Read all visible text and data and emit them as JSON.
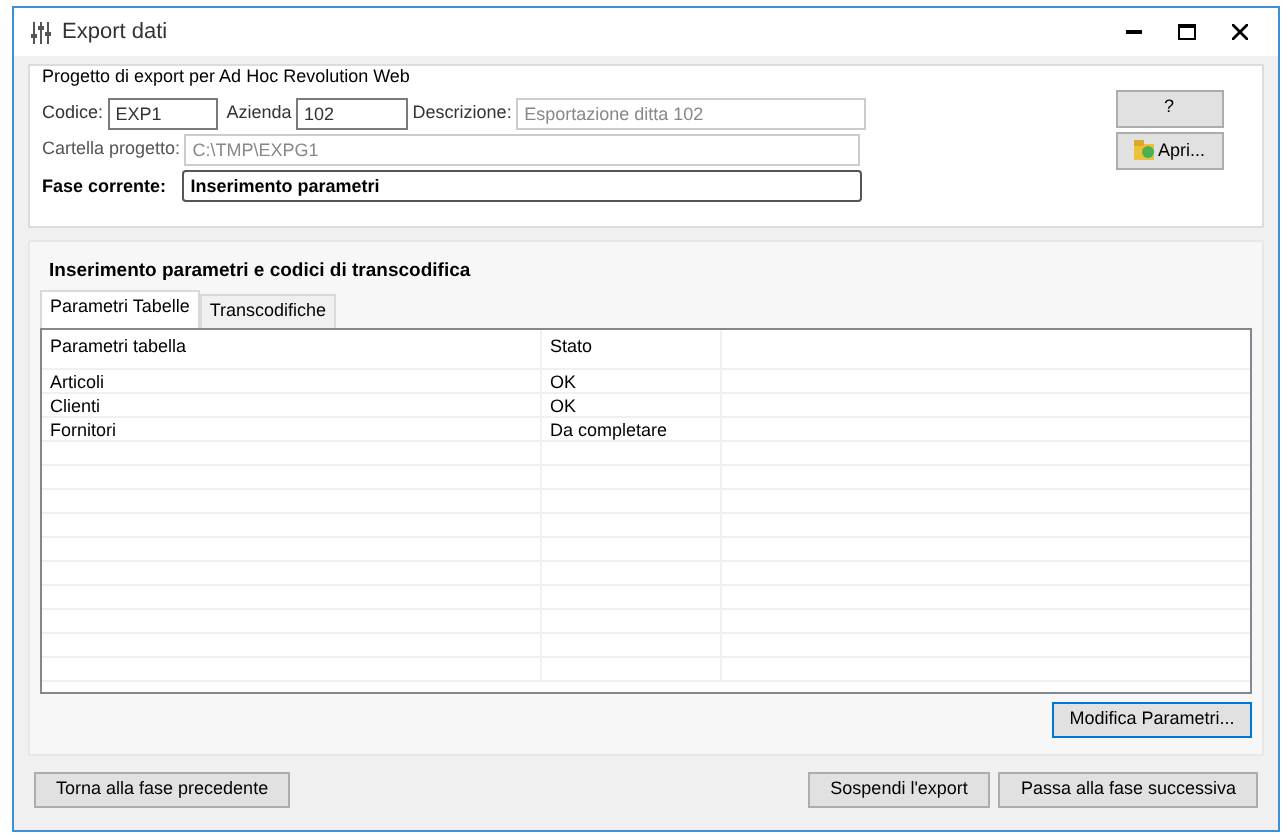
{
  "window": {
    "title": "Export dati"
  },
  "project": {
    "legend": "Progetto di export per Ad Hoc Revolution Web",
    "codice_label": "Codice:",
    "codice": "EXP1",
    "azienda_label": "Azienda",
    "azienda": "102",
    "descrizione_label": "Descrizione:",
    "descrizione": "Esportazione ditta 102",
    "cartella_label": "Cartella progetto:",
    "cartella": "C:\\TMP\\EXPG1",
    "fase_label": "Fase corrente:",
    "fase": "Inserimento parametri",
    "help_button": "?",
    "open_button": "Apri..."
  },
  "section_title": "Inserimento parametri e codici di transcodifica",
  "tabs": [
    {
      "label": "Parametri Tabelle",
      "selected": true
    },
    {
      "label": "Transcodifiche",
      "selected": false
    }
  ],
  "table": {
    "columns": [
      "Parametri tabella",
      "Stato"
    ],
    "rows": [
      {
        "cells": [
          "Articoli",
          "OK"
        ]
      },
      {
        "cells": [
          "Clienti",
          "OK"
        ]
      },
      {
        "cells": [
          "Fornitori",
          "Da completare"
        ]
      }
    ]
  },
  "modify_button": "Modifica Parametri...",
  "buttons": [
    "Torna alla fase precedente",
    "Sospendi l'export",
    "Passa alla fase successiva"
  ]
}
